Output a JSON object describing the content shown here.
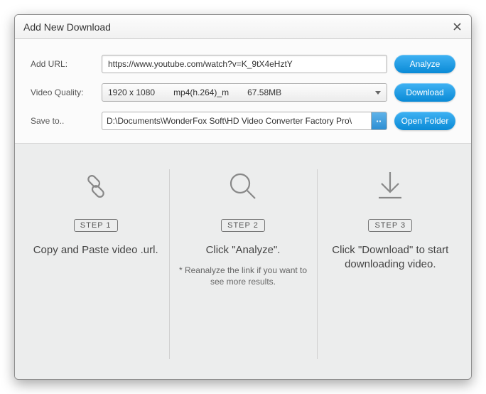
{
  "window": {
    "title": "Add New Download"
  },
  "form": {
    "url_label": "Add URL:",
    "url_value": "https://www.youtube.com/watch?v=K_9tX4eHztY",
    "analyze_label": "Analyze",
    "quality_label": "Video Quality:",
    "quality_resolution": "1920 x 1080",
    "quality_codec": "mp4(h.264)_m",
    "quality_size": "67.58MB",
    "download_label": "Download",
    "save_label": "Save to..",
    "save_path": "D:\\Documents\\WonderFox Soft\\HD Video Converter Factory Pro\\",
    "browse_glyph": "▪▪",
    "open_folder_label": "Open Folder"
  },
  "steps": [
    {
      "badge": "STEP 1",
      "text": "Copy and Paste video .url.",
      "note": ""
    },
    {
      "badge": "STEP 2",
      "text": "Click \"Analyze\".",
      "note": "* Reanalyze the link if you want to see more results."
    },
    {
      "badge": "STEP 3",
      "text": "Click \"Download\" to start downloading video.",
      "note": ""
    }
  ]
}
